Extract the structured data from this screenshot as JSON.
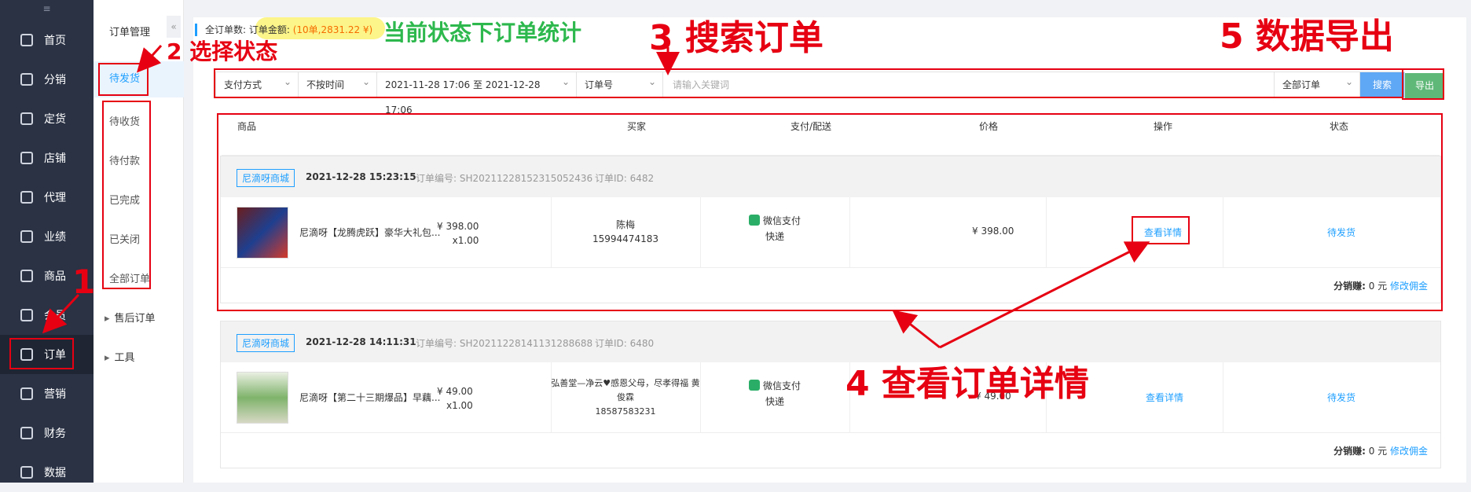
{
  "sidebar": {
    "top_icon": "≡",
    "items": [
      {
        "label": "首页",
        "icon": "home-icon"
      },
      {
        "label": "分销",
        "icon": "user-icon"
      },
      {
        "label": "定货",
        "icon": "chart-icon"
      },
      {
        "label": "店铺",
        "icon": "store-icon"
      },
      {
        "label": "代理",
        "icon": "agent-icon"
      },
      {
        "label": "业绩",
        "icon": "performance-icon"
      },
      {
        "label": "商品",
        "icon": "goods-icon"
      },
      {
        "label": "会员",
        "icon": "member-icon"
      },
      {
        "label": "订单",
        "icon": "order-icon"
      },
      {
        "label": "营销",
        "icon": "marketing-icon"
      },
      {
        "label": "财务",
        "icon": "finance-icon"
      },
      {
        "label": "数据",
        "icon": "data-icon"
      }
    ]
  },
  "subnav": {
    "title": "订单管理",
    "collapse": "«",
    "items": [
      "待发货",
      "待收货",
      "待付款",
      "已完成",
      "已关闭",
      "全部订单"
    ],
    "groups": [
      "售后订单",
      "工具"
    ]
  },
  "stats": {
    "label": "全订单数: 订单金额: ",
    "value": "(10单,2831.22 ¥)"
  },
  "filter": {
    "pay_method": "支付方式",
    "time_mode": "不按时间",
    "date_range": "2021-11-28 17:06 至 2021-12-28 17:06",
    "field": "订单号",
    "keyword_placeholder": "请输入关键词",
    "scope": "全部订单",
    "search_label": "搜索",
    "export_label": "导出"
  },
  "table_headers": [
    "商品",
    "买家",
    "支付/配送",
    "价格",
    "操作",
    "状态"
  ],
  "orders": [
    {
      "shop": "尼滴呀商城",
      "time": "2021-12-28  15:23:15",
      "order_no": "订单编号: SH20211228152315052436",
      "order_id": "订单ID: 6482",
      "product": "尼滴呀【龙腾虎跃】豪华大礼包...",
      "unit_price": "¥ 398.00",
      "qty": "x1.00",
      "buyer_name": "陈梅",
      "buyer_phone": "15994474183",
      "pay": "微信支付",
      "ship": "快递",
      "amount": "¥ 398.00",
      "action": "查看详情",
      "status": "待发货",
      "commission_label": "分销赚:",
      "commission_value": " 0 元 ",
      "commission_link": "修改佣金"
    },
    {
      "shop": "尼滴呀商城",
      "time": "2021-12-28  14:11:31",
      "order_no": "订单编号: SH20211228141131288688",
      "order_id": "订单ID: 6480",
      "product": "尼滴呀【第二十三期爆品】早藕...",
      "unit_price": "¥ 49.00",
      "qty": "x1.00",
      "buyer_name": "弘善堂—净云♥感恩父母，尽孝得福 黄俊霖",
      "buyer_phone": "18587583231",
      "pay": "微信支付",
      "ship": "快递",
      "amount": "¥ 49.00",
      "action": "查看详情",
      "status": "待发货",
      "commission_label": "分销赚:",
      "commission_value": " 0 元 ",
      "commission_link": "修改佣金"
    }
  ],
  "annotations": {
    "a1": "1",
    "a2": "2 选择状态",
    "a3": "3 搜索订单",
    "a4": "4 查看订单详情",
    "a5": "5 数据导出",
    "stats_note": "当前状态下订单统计"
  },
  "colors": {
    "sidebar_bg": "#2a3244",
    "accent_blue": "#1e9fff",
    "export_green": "#5fb878",
    "annotation_red": "#e60012",
    "annotation_green": "#2db84d"
  }
}
